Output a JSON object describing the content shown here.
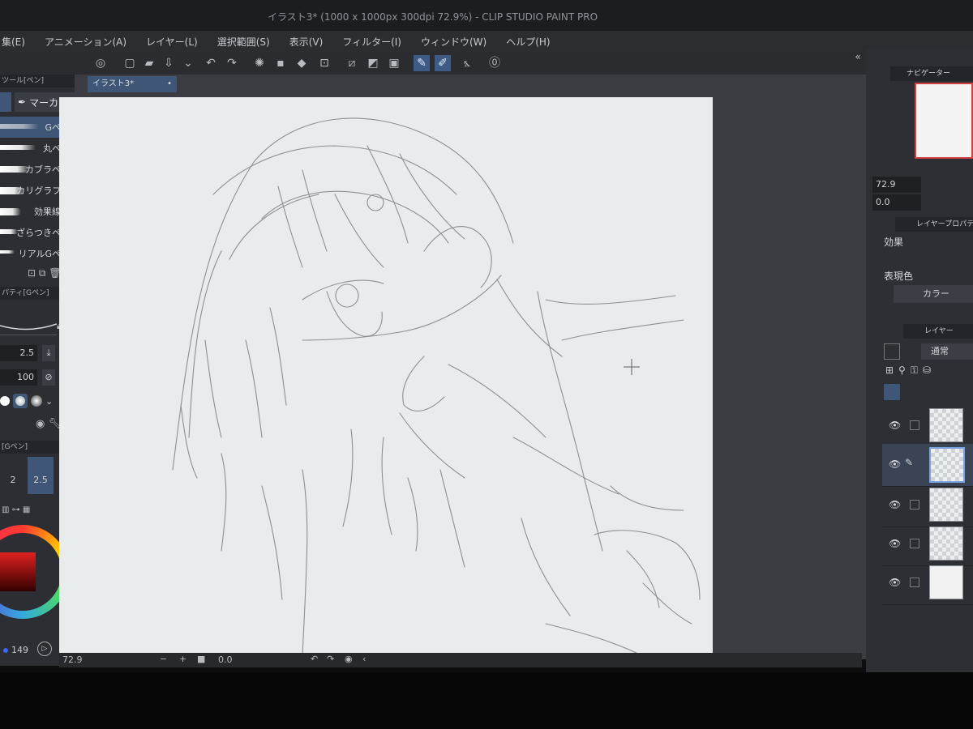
{
  "window": {
    "title": "イラスト3* (1000 x 1000px 300dpi 72.9%) - CLIP STUDIO PAINT PRO"
  },
  "menu": [
    "集(E)",
    "アニメーション(A)",
    "レイヤー(L)",
    "選択範囲(S)",
    "表示(V)",
    "フィルター(I)",
    "ウィンドウ(W)",
    "ヘルプ(H)"
  ],
  "left": {
    "subtool_header": "ツール[ペン]",
    "subtool_tab": "マーカー",
    "brushes": [
      "Gペン",
      "丸ペン",
      "カブラペン",
      "カリグラフィ",
      "効果線用",
      "ざらつきペン",
      "リアルGペン"
    ],
    "property_header": "パティ[Gペン]",
    "brush_size": "2.5",
    "opacity": "100",
    "size_header": "[Gペン]",
    "size_options": [
      "2",
      "2.5"
    ],
    "color_value": "149"
  },
  "canvas": {
    "tab_label": "イラスト3*",
    "zoom": "72.9",
    "rotation": "0.0"
  },
  "right": {
    "navigator_label": "ナビゲーター",
    "nav_zoom": "72.9",
    "nav_angle": "0.0",
    "layer_property_label": "レイヤープロパティ",
    "effect_label": "効果",
    "expression_color_label": "表現色",
    "color_button_label": "カラー",
    "layer_panel_label": "レイヤー",
    "blend_mode": "通常"
  },
  "colors": {
    "accent": "#3f5676",
    "panel": "#2c2e33",
    "paper": "#e9ecec"
  }
}
